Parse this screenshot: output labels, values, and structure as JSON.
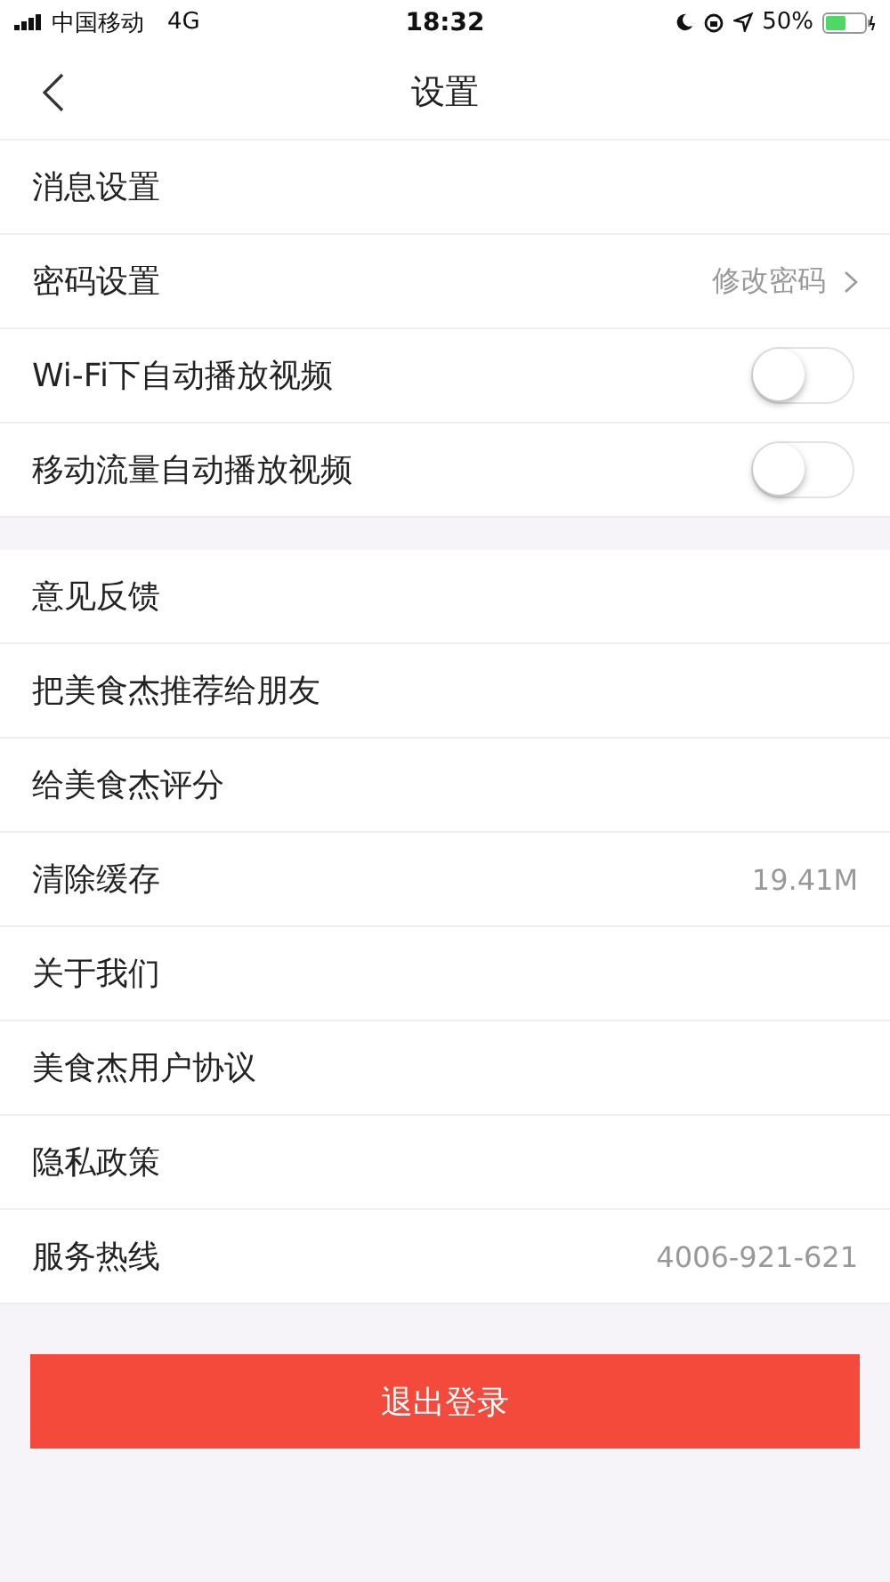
{
  "status_bar": {
    "carrier": "中国移动",
    "network": "4G",
    "time": "18:32",
    "battery": "50%"
  },
  "nav": {
    "title": "设置"
  },
  "groups": [
    {
      "rows": [
        {
          "kind": "link",
          "label": "消息设置",
          "chevron": false
        },
        {
          "kind": "link",
          "label": "密码设置",
          "value": "修改密码",
          "chevron": true
        },
        {
          "kind": "toggle",
          "label": "Wi-Fi下自动播放视频",
          "on": false
        },
        {
          "kind": "toggle",
          "label": "移动流量自动播放视频",
          "on": false
        }
      ]
    },
    {
      "rows": [
        {
          "kind": "link",
          "label": "意见反馈",
          "chevron": false
        },
        {
          "kind": "link",
          "label": "把美食杰推荐给朋友",
          "chevron": false
        },
        {
          "kind": "link",
          "label": "给美食杰评分",
          "chevron": false
        },
        {
          "kind": "link",
          "label": "清除缓存",
          "value": "19.41M",
          "chevron": false
        },
        {
          "kind": "link",
          "label": "关于我们",
          "chevron": false
        },
        {
          "kind": "link",
          "label": "美食杰用户协议",
          "chevron": false
        },
        {
          "kind": "link",
          "label": "隐私政策",
          "chevron": false
        },
        {
          "kind": "link",
          "label": "服务热线",
          "value": "4006-921-621",
          "chevron": false
        }
      ]
    }
  ],
  "logout_button": "退出登录"
}
